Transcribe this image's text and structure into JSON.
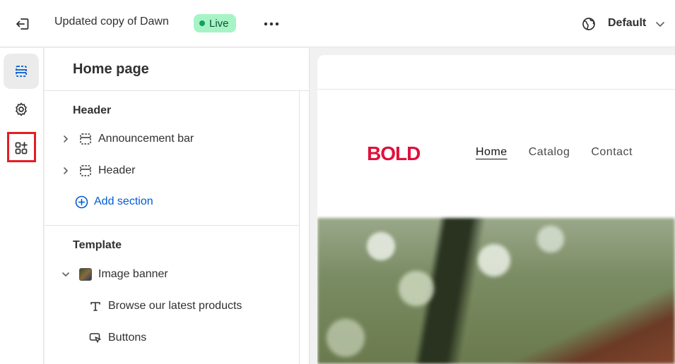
{
  "topbar": {
    "theme_name": "Updated copy of Dawn",
    "status_badge": "Live",
    "locale": "Default",
    "colors": {
      "live_badge_bg": "#a6f4c5",
      "live_dot": "#14a05f"
    }
  },
  "rail": {
    "items": [
      {
        "icon": "sections-icon",
        "active": true
      },
      {
        "icon": "gear-icon",
        "active": false
      },
      {
        "icon": "app-embeds-icon",
        "active": false,
        "highlighted": true
      }
    ]
  },
  "panel": {
    "title": "Home page",
    "header_group": {
      "label": "Header",
      "items": [
        {
          "label": "Announcement bar",
          "icon": "section-layout-icon"
        },
        {
          "label": "Header",
          "icon": "section-layout-icon"
        }
      ],
      "add_section": "Add section"
    },
    "template_group": {
      "label": "Template",
      "items": [
        {
          "label": "Image banner",
          "icon": "image-thumbnail",
          "expanded": true,
          "children": [
            {
              "label": "Browse our latest products",
              "icon": "text-icon"
            },
            {
              "label": "Buttons",
              "icon": "button-cursor-icon"
            }
          ]
        }
      ]
    }
  },
  "preview": {
    "logo_text": "BOLD",
    "logo_color": "#e0103a",
    "nav": [
      "Home",
      "Catalog",
      "Contact"
    ]
  }
}
